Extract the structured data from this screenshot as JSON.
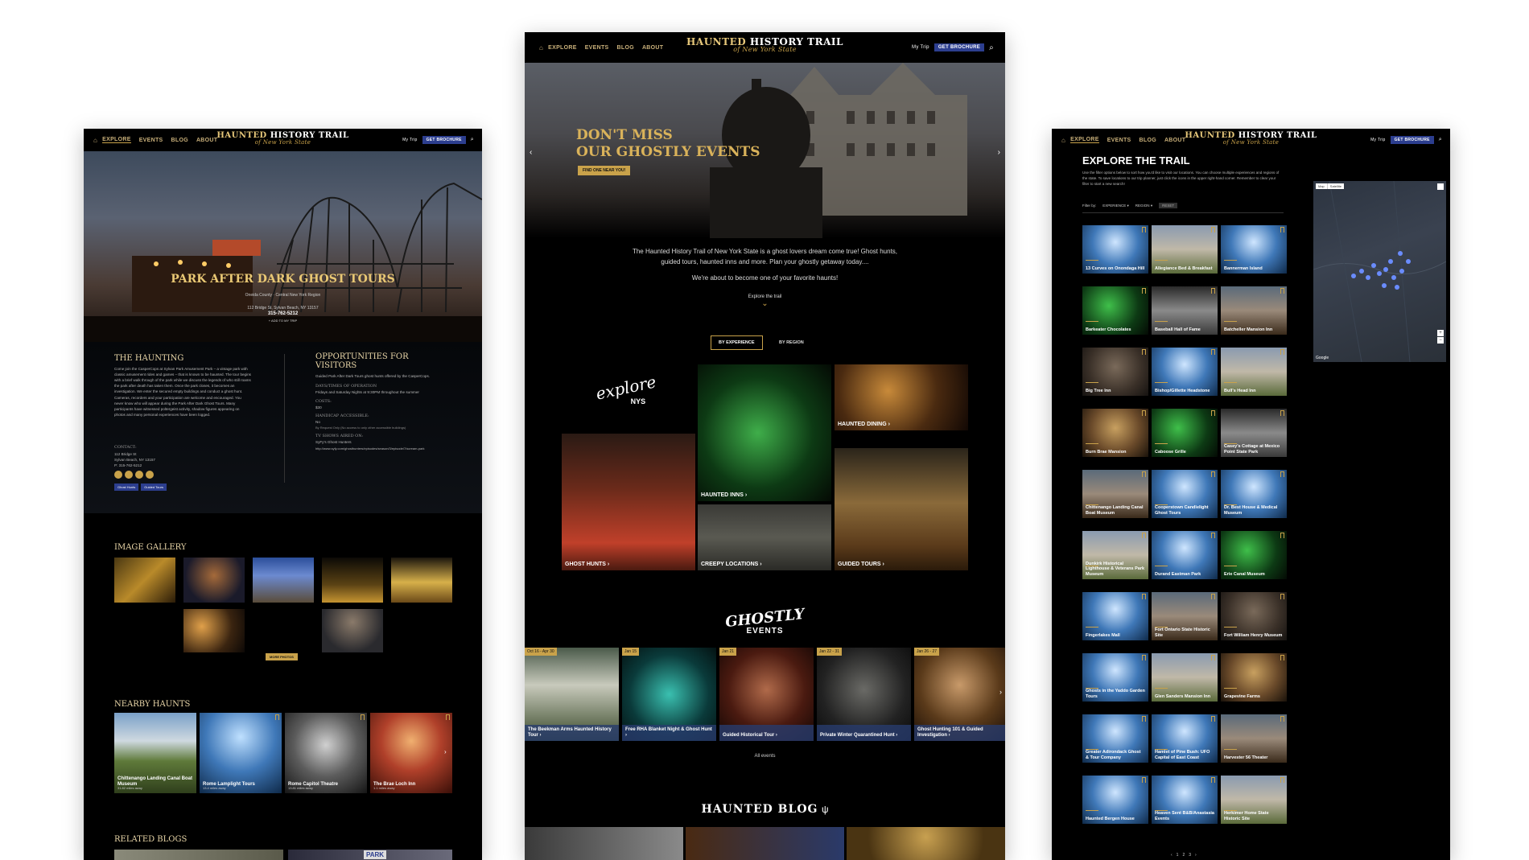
{
  "nav": {
    "items": [
      "Explore",
      "Events",
      "Blog",
      "About"
    ],
    "logo_line1_a": "HAUNTED",
    "logo_line1_b": "HISTORY TRAIL",
    "logo_line2": "of New York State",
    "my_trip": "My Trip",
    "brochure": "GET BROCHURE"
  },
  "left": {
    "hero_title": "PARK AFTER DARK GHOST TOURS",
    "hero_county": "Oneida County · Central New York Region",
    "hero_address": "112 Bridge St, Sylvan Beach, NY 13157",
    "hero_phone": "315-762-5212",
    "add_trip": "ADD TO MY TRIP",
    "haunting_title": "THE HAUNTING",
    "haunting_text": "Come join the CasperCops at Sylvan Park Amusement Park – a vintage park with classic amusement rides and games – that is known to be haunted. The tour begins with a brief walk through of the park while we discuss the legends of who still roams the park after death has taken them. Once the park closes, it becomes an investigation. We enter the secured empty buildings and conduct a ghost hunt. Cameras, recorders and your participation are welcome and encouraged. You never know who will appear during the Park After Dark Ghost Tours. Many participants have witnessed poltergeist activity, shadow figures appearing on photos and many personal experiences have been logged.",
    "contact_label": "CONTACT:",
    "contact_lines": [
      "112 Bridge St",
      "Sylvan Beach, NY 13157",
      "P: 315-762-5212"
    ],
    "tags": [
      "Ghost Hunts",
      "Guided Tours"
    ],
    "opp_title": "OPPORTUNITIES FOR VISITORS",
    "opp_text": "Guided Park After Dark Tours ghost hunts offered by the CasperCops.",
    "days_label": "DAYS/TIMES OF OPERATION",
    "days_text": "Fridays and Saturday Nights at 9:30PM throughout the summer",
    "costs_label": "COSTS:",
    "costs_text": "$30",
    "handicap_label": "HANDICAP ACCESSIBLE:",
    "handicap_text": "No",
    "handicap_note": "By Request Only (No access to only other accessible buildings)",
    "tv_label": "TV SHOWS AIRED ON:",
    "tv_text": "SyFy's Ghost Hunters",
    "tv_link": "http://www.syfy.com/ghosthunters/episodes/season/3/episode/7/scream-park",
    "gallery_title": "IMAGE GALLERY",
    "more_photos": "MORE PHOTOS",
    "nearby_title": "NEARBY HAUNTS",
    "nearby": [
      {
        "name": "Chittenango Landing Canal Boat Museum",
        "dist": "31.82 miles away"
      },
      {
        "name": "Rome Lamplight Tours",
        "dist": "13.4 miles away"
      },
      {
        "name": "Rome Capitol Theatre",
        "dist": "13.81 miles away"
      },
      {
        "name": "The Brae Loch Inn",
        "dist": "1.1 miles away"
      }
    ],
    "related_title": "RELATED BLOGS",
    "related_sign": "PARK"
  },
  "center": {
    "hero_title_1": "DON'T MISS",
    "hero_title_2": "OUR GHOSTLY EVENTS",
    "hero_btn": "FIND ONE NEAR YOU!",
    "intro": "The Haunted History Trail of New York State is a ghost lovers dream come true! Ghost hunts, guided tours, haunted inns and more. Plan your ghostly getaway today....",
    "intro2": "We're about to become one of your favorite haunts!",
    "explore": "Explore the trail",
    "tab_exp": "BY EXPERIENCE",
    "tab_region": "BY REGION",
    "explore_logo": "explore",
    "explore_nys": "NYS",
    "tiles": [
      "HAUNTED INNS",
      "HAUNTED DINING",
      "GHOST HUNTS",
      "CREEPY LOCATIONS",
      "GUIDED TOURS"
    ],
    "events_logo_1": "GHOSTLY",
    "events_logo_2": "EVENTS",
    "events": [
      {
        "date": "Oct 16 - Apr 30",
        "name": "The Beekman Arms Haunted History Tour"
      },
      {
        "date": "Jan 15",
        "name": "Free RHA Blanket Night & Ghost Hunt"
      },
      {
        "date": "Jan 21",
        "name": "Guided Historical Tour"
      },
      {
        "date": "Jan 22 - 31",
        "name": "Private Winter Quarantined Hunt"
      },
      {
        "date": "Jan 26 - 27",
        "name": "Ghost Hunting 101 & Guided Investigation"
      }
    ],
    "all_events": "All events",
    "blog_title": "HAUNTED BLOG"
  },
  "right": {
    "title": "EXPLORE THE TRAIL",
    "desc": "Use the filter options below to sort how you'd like to visit our locations. You can choose multiple experiences and regions of the state. To save locations to our trip planner, just click the icons in the upper right-hand corner. Remember to clear your filter to start a new search!",
    "filter_by": "Filter by:",
    "filters": [
      "EXPERIENCE",
      "REGION"
    ],
    "reset": "RESET",
    "map_btns": [
      "Map",
      "Satellite"
    ],
    "map_google": "Google",
    "places": [
      "13 Curves on Onondaga Hill",
      "Allegiance Bed & Breakfast",
      "Bannerman Island",
      "Barkeater Chocolates",
      "Baseball Hall of Fame",
      "Batcheller Mansion Inn",
      "Big Tree Inn",
      "Bishop/Gillette Headstone",
      "Bull's Head Inn",
      "Burn Brae Mansion",
      "Caboose Grille",
      "Casey's Cottage at Mexico Point State Park",
      "Chittenango Landing Canal Boat Museum",
      "Cooperstown Candlelight Ghost Tours",
      "Dr. Best House & Medical Museum",
      "Dunkirk Historical Lighthouse & Veterans Park Museum",
      "Durand Eastman Park",
      "Erie Canal Museum",
      "Fingerlakes Mall",
      "Fort Ontario State Historic Site",
      "Fort William Henry Museum",
      "Ghosts in the Yaddo Garden Tours",
      "Glen Sanders Mansion Inn",
      "Grapevine Farms",
      "Greater Adirondack Ghost & Tour Company",
      "Hamlet of Pine Bush: UFO Capital of East Coast",
      "Harvester 56 Theater",
      "Haunted Bergen House",
      "Heaven Sent B&B/Anastasia Events",
      "Herkimer Home State Historic Site"
    ],
    "pages": [
      "1",
      "2",
      "3"
    ]
  }
}
